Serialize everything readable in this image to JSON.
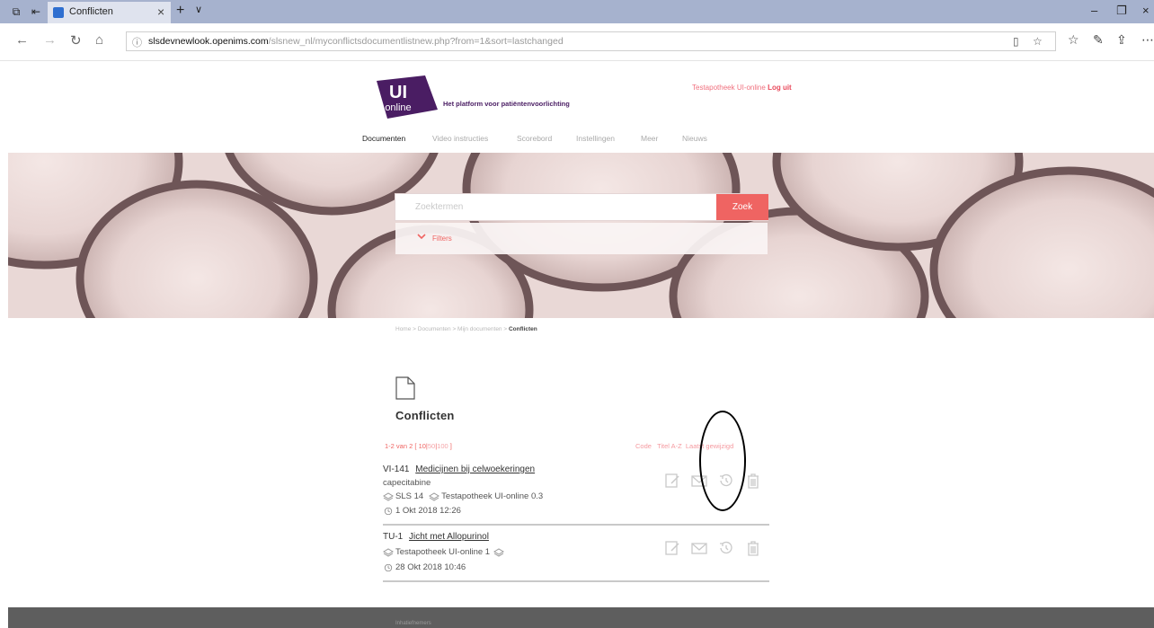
{
  "browser": {
    "tab_title": "Conflicten",
    "url_host": "slsdevnewlook.openims.com",
    "url_path": "/slsnew_nl/myconflictsdocumentlistnew.php?from=1&sort=lastchanged"
  },
  "site": {
    "logo_top": "UI",
    "logo_bottom": "online",
    "tagline": "Het platform voor patiëntenvoorlichting",
    "login_user": "Testapotheek UI-online",
    "logout_label": "Log uit"
  },
  "nav": {
    "items": [
      {
        "label": "Documenten",
        "active": true
      },
      {
        "label": "Video instructies",
        "active": false
      },
      {
        "label": "Scorebord",
        "active": false
      },
      {
        "label": "Instellingen",
        "active": false
      },
      {
        "label": "Meer",
        "active": false
      },
      {
        "label": "Nieuws",
        "active": false
      }
    ]
  },
  "search": {
    "placeholder": "Zoektermen",
    "button_label": "Zoek",
    "filters_label": "Filters"
  },
  "breadcrumb": {
    "items": [
      "Home",
      "Documenten",
      "Mijn documenten"
    ],
    "separator": ">",
    "current": "Conflicten"
  },
  "page": {
    "title": "Conflicten"
  },
  "pager": {
    "summary": "1-2 van 2",
    "open": "[",
    "sizes": [
      "10",
      "50",
      "100"
    ],
    "close": "]"
  },
  "sort": {
    "options": [
      "Code",
      "Titel A-Z",
      "Laatst gewijzigd"
    ]
  },
  "documents": [
    {
      "code": "VI-141",
      "title": "Medicijnen bij celwoekeringen",
      "subtitle": "capecitabine",
      "meta1": "SLS 14",
      "meta2": "Testapotheek UI-online 0.3",
      "date": "1 Okt 2018 12:26"
    },
    {
      "code": "TU-1",
      "title": "Jicht met Allopurinol",
      "meta1": "Testapotheek UI-online 1",
      "date": "28 Okt 2018 10:46"
    }
  ],
  "footer": {
    "label": "Inhatiefnemers"
  },
  "colors": {
    "accent": "#ef6462",
    "brand_purple": "#4a1d63"
  }
}
